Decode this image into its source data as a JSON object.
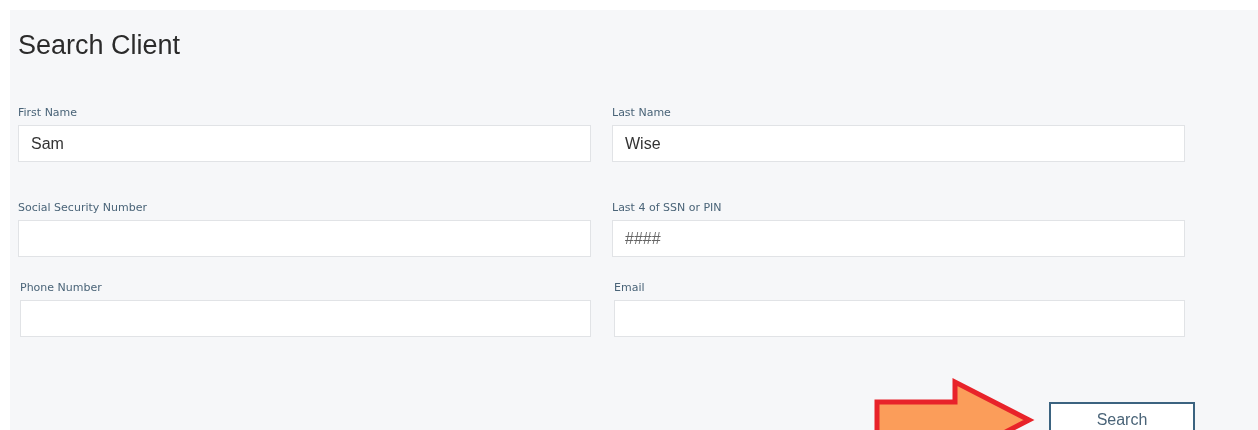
{
  "title": "Search Client",
  "fields": [
    {
      "label": "First Name",
      "value": "Sam"
    },
    {
      "label": "Last Name",
      "value": "Wise"
    },
    {
      "label": "Social Security Number"
    },
    {
      "label": "Last 4 of SSN or PIN",
      "placeholder": "####"
    },
    {
      "label": "Phone Number"
    },
    {
      "label": "Email"
    }
  ],
  "search_button": "Search"
}
